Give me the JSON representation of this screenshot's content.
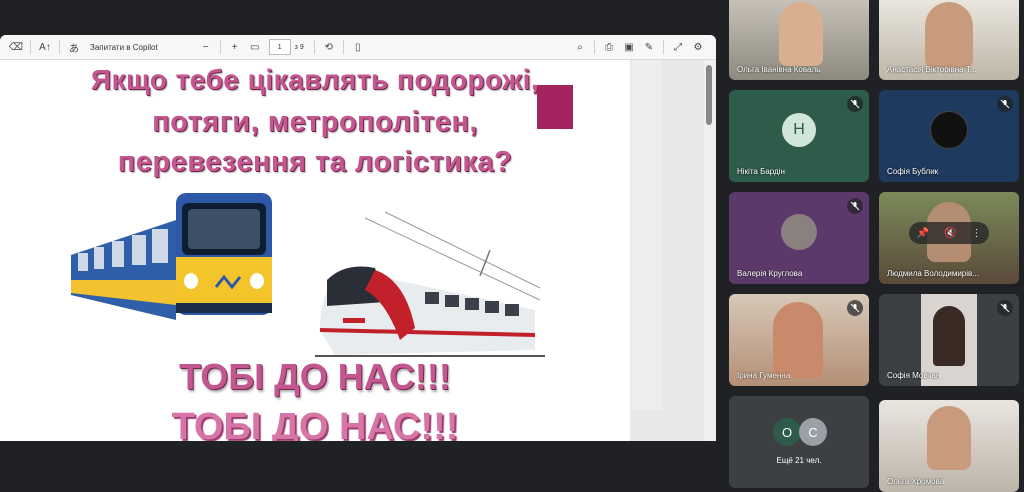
{
  "toolbar": {
    "copilot_label": "Запитати в Copilot",
    "page_current": "1",
    "page_total": "з 9"
  },
  "slide": {
    "headline_line1": "Якщо тебе цікавлять подорожі,",
    "headline_line2": "потяги, метрополітен,",
    "headline_line3": "перевезення та логістика?",
    "callout": "ТОБІ ДО НАС!!!",
    "callout_repeat": "ТОБІ ДО НАС!!!"
  },
  "participants": [
    {
      "name": "Ольга Іванівна Коваль",
      "muted": false
    },
    {
      "name": "Анастасія Вікторівна Т...",
      "muted": false
    },
    {
      "name": "Нікіта Бардін",
      "initial": "Н",
      "muted": true
    },
    {
      "name": "Софія Бублик",
      "muted": true
    },
    {
      "name": "Валерія Круглова",
      "muted": true
    },
    {
      "name": "Людмила Володимирів...",
      "muted": true
    },
    {
      "name": "Ірина Гуменна",
      "muted": true
    },
    {
      "name": "Софія Мовчан",
      "muted": true
    },
    {
      "name": "Ольга Хромова",
      "muted": false
    }
  ],
  "more": {
    "label": "Ещё 21 чел.",
    "avatar1": "О",
    "avatar2": "С"
  },
  "colors": {
    "slide_text": "#c2588f",
    "slide_accent": "#a3245f",
    "meet_bg": "#202124",
    "tile_green": "#2e5b4a",
    "tile_navy": "#1f3a5f",
    "tile_purple": "#5b3a6b"
  }
}
